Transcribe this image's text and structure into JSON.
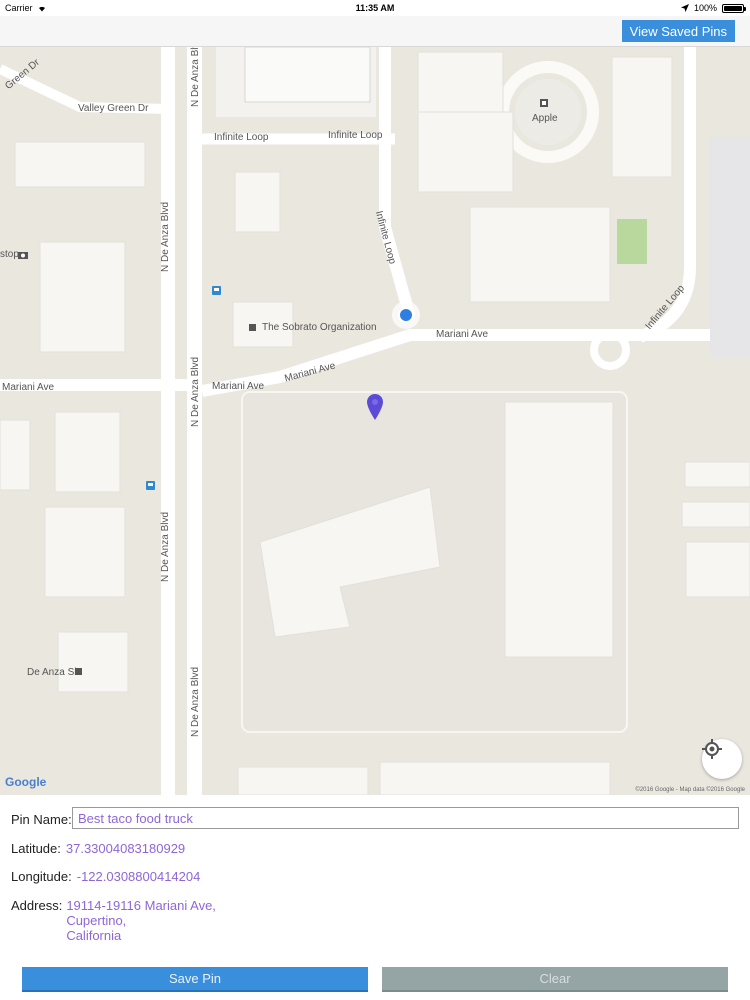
{
  "status_bar": {
    "carrier": "Carrier",
    "time": "11:35 AM",
    "battery": "100%"
  },
  "navbar": {
    "view_saved_label": "View Saved Pins"
  },
  "map": {
    "labels": {
      "valley_green_dr_1": "Valley Green Dr",
      "green_dr_partial": "Green Dr",
      "infinite_loop_1": "Infinite Loop",
      "infinite_loop_2": "Infinite Loop",
      "infinite_loop_vertical": "Infinite Loop",
      "infinite_loop_diag": "Infinite Loop",
      "apple": "Apple",
      "n_de_anza_1": "N De Anza Blvd",
      "n_de_anza_2": "N De Anza Blvd",
      "n_de_anza_3": "N De Anza Blvd",
      "n_de_anza_4": "N De Anza Blvd",
      "n_de_anza_5": "N De Anza Blvd",
      "n_de_anza_6": "N De Anza Blvd",
      "sobrato": "The Sobrato Organization",
      "mariani_1": "Mariani Ave",
      "mariani_2": "Mariani Ave",
      "mariani_3": "Mariani Ave",
      "mariani_4": "Mariani Ave",
      "stop_partial": "stop",
      "de_anza_six": "De Anza Six"
    },
    "google_logo": "Google",
    "attribution": "©2016 Google - Map data ©2016 Google"
  },
  "form": {
    "pin_name_label": "Pin Name:",
    "pin_name_value": "Best taco food truck",
    "latitude_label": "Latitude:",
    "latitude_value": "37.33004083180929",
    "longitude_label": "Longitude:",
    "longitude_value": "-122.0308800414204",
    "address_label": "Address:",
    "address_line1": "19114-19116 Mariani Ave,",
    "address_line2": "Cupertino,",
    "address_line3": "California"
  },
  "buttons": {
    "save_label": "Save Pin",
    "clear_label": "Clear"
  },
  "colors": {
    "accent": "#3a8fdd",
    "value_text": "#8e66d8",
    "clear_button": "#95a5a5",
    "map_background": "#eae7df",
    "pin": "#5d4bd8"
  }
}
